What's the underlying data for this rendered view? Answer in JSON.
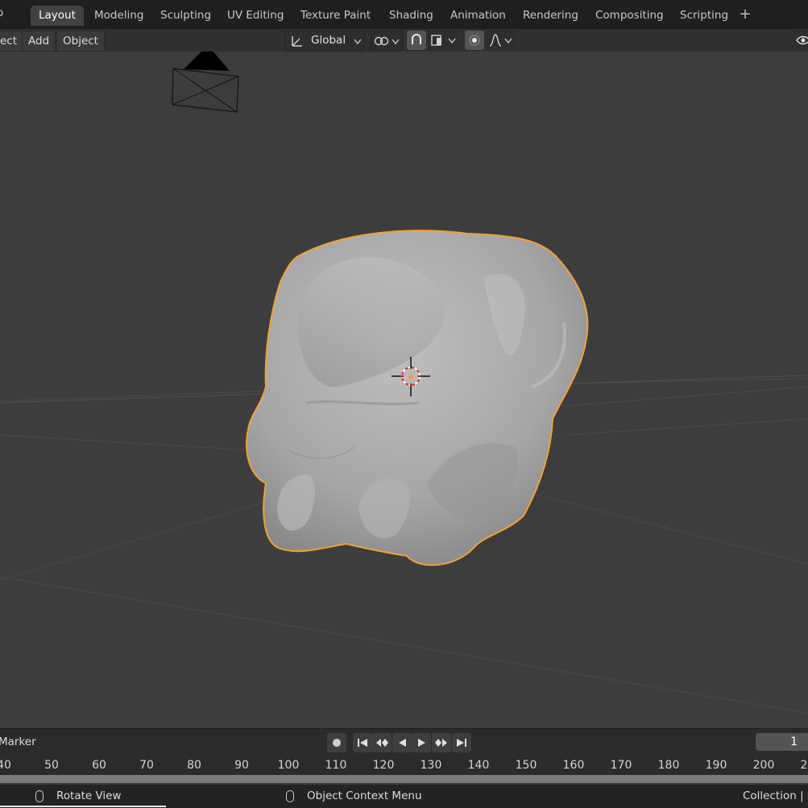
{
  "app_menu_edge": "p",
  "workspace_tabs": [
    {
      "label": "Layout",
      "active": true
    },
    {
      "label": "Modeling"
    },
    {
      "label": "Sculpting"
    },
    {
      "label": "UV Editing"
    },
    {
      "label": "Texture Paint"
    },
    {
      "label": "Shading"
    },
    {
      "label": "Animation"
    },
    {
      "label": "Rendering"
    },
    {
      "label": "Compositing"
    },
    {
      "label": "Scripting"
    }
  ],
  "add_workspace": "+",
  "header": {
    "select_partial": "ect",
    "add": "Add",
    "object": "Object",
    "orientation": "Global"
  },
  "colors": {
    "selection_outline": "#f5a035",
    "mesh": "#a9a9a9",
    "viewport_bg": "#3d3d3d"
  },
  "timeline": {
    "marker_partial": "Marker",
    "current_frame": "1",
    "ruler": [
      "40",
      "50",
      "60",
      "70",
      "80",
      "90",
      "100",
      "110",
      "120",
      "130",
      "140",
      "150",
      "160",
      "170",
      "180",
      "190",
      "200",
      "2"
    ]
  },
  "status": {
    "left_action": "Rotate View",
    "middle_action": "Object Context Menu",
    "right_info": "Collection | S"
  }
}
